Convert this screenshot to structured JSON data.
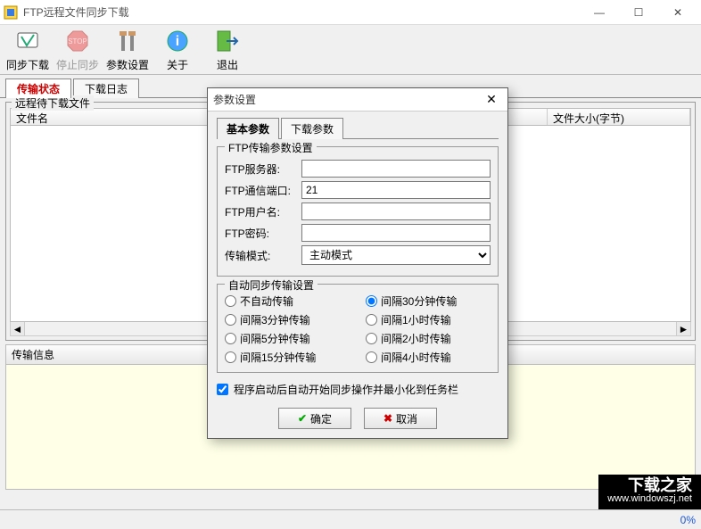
{
  "window": {
    "title": "FTP远程文件同步下载"
  },
  "winbtns": {
    "min": "—",
    "max": "☐",
    "close": "✕"
  },
  "toolbar": {
    "sync": "同步下载",
    "stop": "停止同步",
    "settings": "参数设置",
    "about": "关于",
    "exit": "退出"
  },
  "tabs": {
    "status": "传输状态",
    "log": "下载日志"
  },
  "list": {
    "group_title": "远程待下载文件",
    "col_filename": "文件名",
    "col_size": "文件大小(字节)"
  },
  "info": {
    "header": "传输信息"
  },
  "status": {
    "percent": "0%"
  },
  "watermark": {
    "line1": "下载之家",
    "line2": "www.windowszj.net"
  },
  "dialog": {
    "title": "参数设置",
    "tab_basic": "基本参数",
    "tab_download": "下载参数",
    "ftp_group": "FTP传输参数设置",
    "ftp_server": "FTP服务器:",
    "ftp_port": "FTP通信端口:",
    "ftp_port_value": "21",
    "ftp_user": "FTP用户名:",
    "ftp_pass": "FTP密码:",
    "transfer_mode": "传输模式:",
    "transfer_mode_value": "主动模式",
    "sync_group": "自动同步传输设置",
    "radios": [
      "不自动传输",
      "间隔30分钟传输",
      "间隔3分钟传输",
      "间隔1小时传输",
      "间隔5分钟传输",
      "间隔2小时传输",
      "间隔15分钟传输",
      "间隔4小时传输"
    ],
    "radio_selected": "间隔30分钟传输",
    "autostart": "程序启动后自动开始同步操作并最小化到任务栏",
    "ok": "确定",
    "cancel": "取消"
  }
}
